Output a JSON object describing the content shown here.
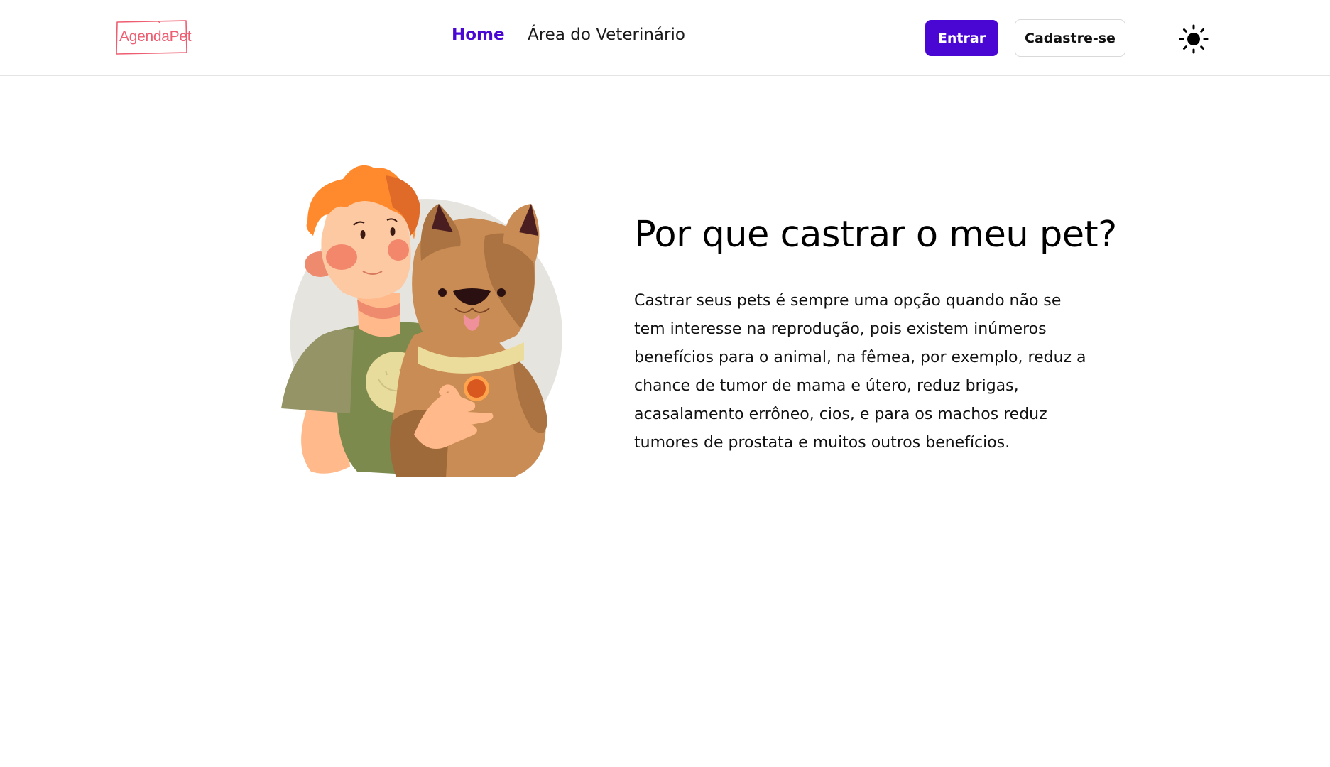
{
  "header": {
    "logo_text": "AgendaPet",
    "nav": {
      "home": "Home",
      "vet_area": "Área do Veterinário"
    },
    "buttons": {
      "login": "Entrar",
      "signup": "Cadastre-se"
    },
    "theme_icon": "sun-icon"
  },
  "hero": {
    "title": "Por que castrar o meu pet?",
    "paragraph": "Castrar seus pets é sempre uma opção quando não se tem interesse na reprodução, pois existem inúmeros benefícios para o animal, na fêmea, por exemplo, reduz a chance de tumor de mama e útero, reduz brigas, acasalamento errôneo, cios, e para os machos reduz tumores de prostata e muitos outros benefícios.",
    "illustration": "boy-hugging-dog-illustration"
  },
  "colors": {
    "accent": "#4a06d2",
    "logo": "#ee5e72"
  }
}
